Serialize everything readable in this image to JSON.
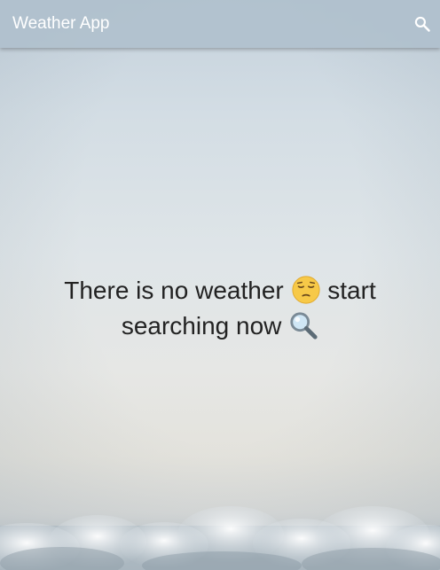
{
  "app": {
    "title": "Weather App"
  },
  "toolbar": {
    "search_icon": "search-icon"
  },
  "empty_state": {
    "line1_text": "There is no weather",
    "line1_emoji": "pensive-face",
    "line1_suffix": "start",
    "line2_text": "searching now",
    "line2_emoji": "magnifying-glass"
  },
  "colors": {
    "appbar": "#b0c0cd",
    "title_text": "#ffffff",
    "message_text": "#222222"
  }
}
